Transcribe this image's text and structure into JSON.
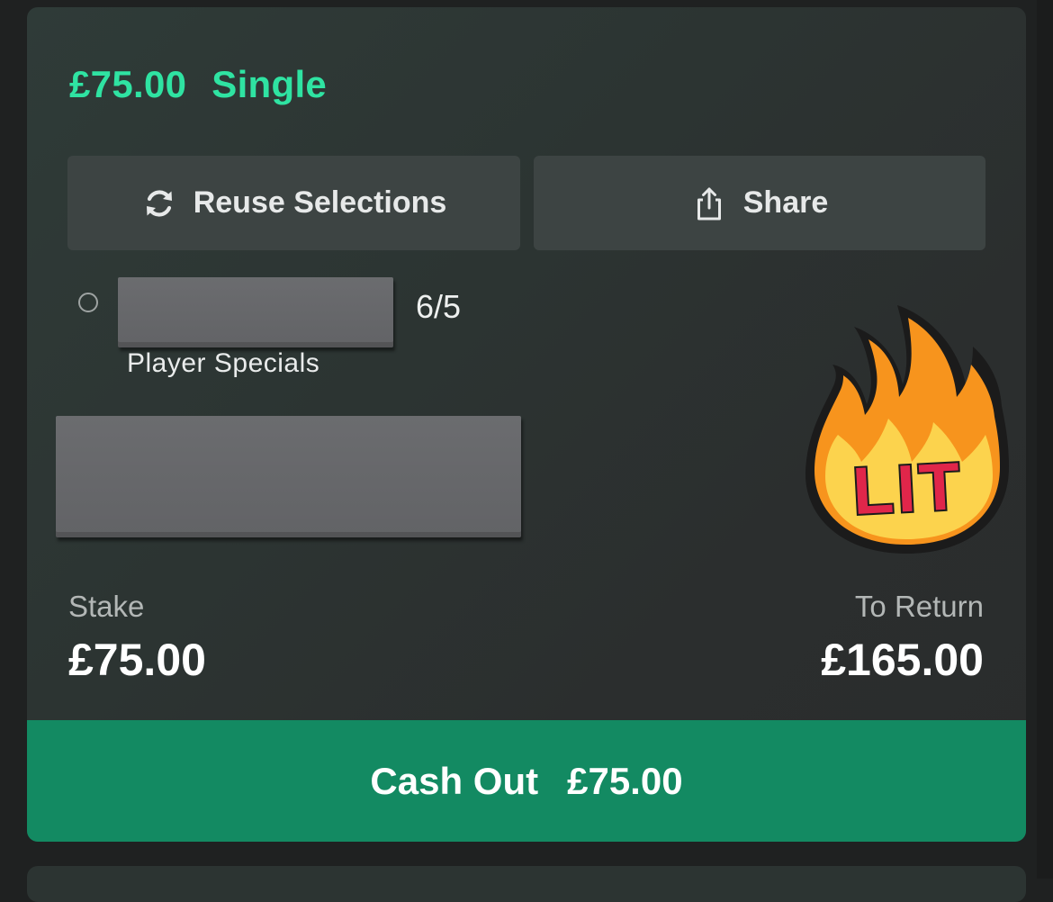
{
  "bet": {
    "amount": "£75.00",
    "type": "Single"
  },
  "actions": {
    "reuse_label": "Reuse Selections",
    "reuse_icon": "refresh-icon",
    "share_label": "Share",
    "share_icon": "share-icon"
  },
  "selection": {
    "odds": "6/5",
    "market": "Player Specials"
  },
  "sticker": {
    "text": "LIT"
  },
  "summary": {
    "stake_label": "Stake",
    "stake_value": "£75.00",
    "return_label": "To Return",
    "return_value": "£165.00"
  },
  "cashout": {
    "label": "Cash Out",
    "amount": "£75.00"
  },
  "colors": {
    "accent": "#2fe3a2",
    "cashout_bg": "#138a62",
    "card_bg": "#2c3432",
    "button_bg": "#3d4443"
  }
}
